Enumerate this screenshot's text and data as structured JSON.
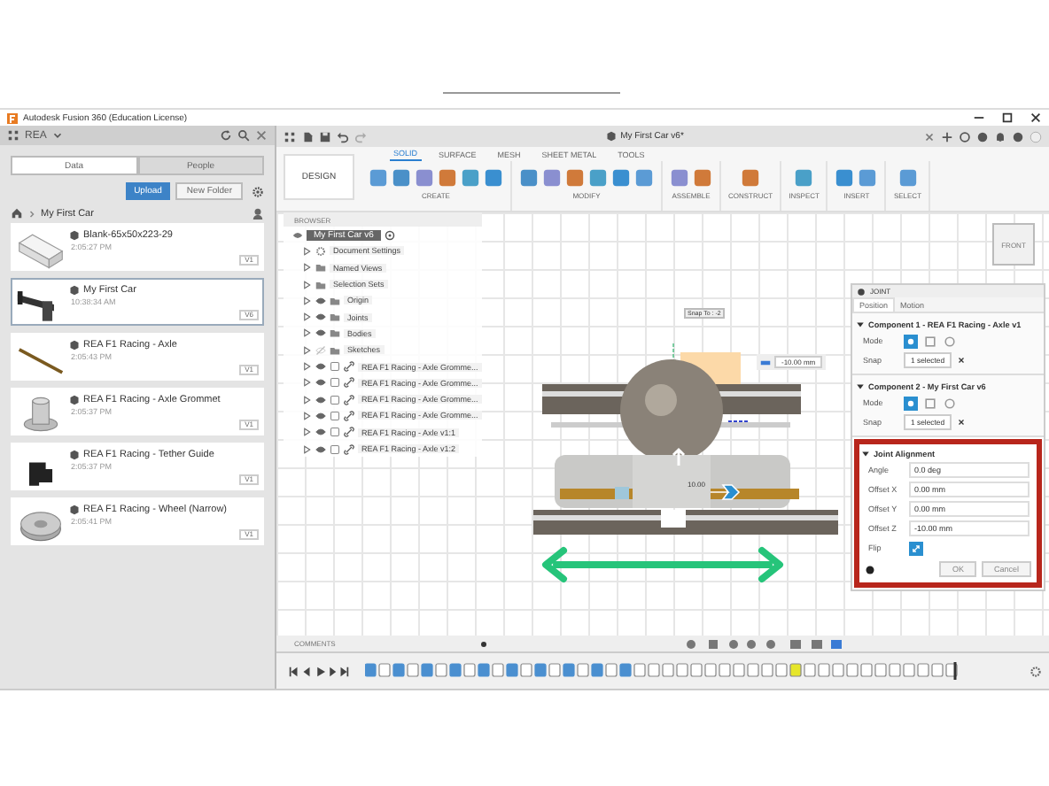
{
  "window": {
    "title": "Autodesk Fusion 360 (Education License)"
  },
  "data_panel": {
    "project": "REA",
    "tabs": [
      {
        "label": "Data",
        "selected": true
      },
      {
        "label": "People",
        "selected": false
      }
    ],
    "upload": "Upload",
    "new_folder": "New Folder",
    "breadcrumb": "My First Car",
    "files": [
      {
        "name": "Blank-65x50x223-29",
        "time": "2:05:27 PM",
        "version": "V1",
        "selected": false,
        "kind": "block"
      },
      {
        "name": "My First Car",
        "time": "10:38:34 AM",
        "version": "V6",
        "selected": true,
        "kind": "car"
      },
      {
        "name": "REA F1 Racing - Axle",
        "time": "2:05:43 PM",
        "version": "V1",
        "selected": false,
        "kind": "rod"
      },
      {
        "name": "REA F1 Racing - Axle Grommet",
        "time": "2:05:37 PM",
        "version": "V1",
        "selected": false,
        "kind": "grommet"
      },
      {
        "name": "REA F1 Racing - Tether Guide",
        "time": "2:05:37 PM",
        "version": "V1",
        "selected": false,
        "kind": "guide"
      },
      {
        "name": "REA F1 Racing - Wheel (Narrow)",
        "time": "2:05:41 PM",
        "version": "V1",
        "selected": false,
        "kind": "wheel"
      }
    ]
  },
  "document_tab": {
    "title": "My First Car v6*"
  },
  "toolbar": {
    "workspace": "DESIGN",
    "tabs": [
      {
        "label": "SOLID",
        "selected": true
      },
      {
        "label": "SURFACE",
        "selected": false
      },
      {
        "label": "MESH",
        "selected": false
      },
      {
        "label": "SHEET METAL",
        "selected": false
      },
      {
        "label": "TOOLS",
        "selected": false
      }
    ],
    "groups": [
      "CREATE",
      "MODIFY",
      "ASSEMBLE",
      "CONSTRUCT",
      "INSPECT",
      "INSERT",
      "SELECT"
    ]
  },
  "browser": {
    "title": "BROWSER",
    "root": "My First Car v6",
    "items": [
      {
        "label": "Document Settings",
        "kind": "settings"
      },
      {
        "label": "Named Views",
        "kind": "views"
      },
      {
        "label": "Selection Sets",
        "kind": "views"
      },
      {
        "label": "Origin",
        "kind": "folder",
        "visible": true
      },
      {
        "label": "Joints",
        "kind": "folder",
        "visible": true
      },
      {
        "label": "Bodies",
        "kind": "folder",
        "visible": true
      },
      {
        "label": "Sketches",
        "kind": "folder",
        "visible": false
      },
      {
        "label": "REA F1 Racing - Axle Gromme...",
        "kind": "component",
        "visible": true
      },
      {
        "label": "REA F1 Racing - Axle Gromme...",
        "kind": "component",
        "visible": true
      },
      {
        "label": "REA F1 Racing - Axle Gromme...",
        "kind": "component",
        "visible": true
      },
      {
        "label": "REA F1 Racing - Axle Gromme...",
        "kind": "component",
        "visible": true
      },
      {
        "label": "REA F1 Racing - Axle v1:1",
        "kind": "component",
        "visible": true
      },
      {
        "label": "REA F1 Racing - Axle v1:2",
        "kind": "component",
        "visible": true
      }
    ]
  },
  "viewcube": {
    "label": "FRONT"
  },
  "canvas": {
    "snap_tooltip": "Snap To : -2",
    "distance_value": "-10.00 mm",
    "dimension": "10.00"
  },
  "joint": {
    "title": "JOINT",
    "tabs": [
      {
        "label": "Position",
        "selected": true
      },
      {
        "label": "Motion",
        "selected": false
      }
    ],
    "components": [
      {
        "header": "Component 1 - REA F1 Racing - Axle v1",
        "mode": "Mode",
        "snap": "Snap",
        "selection": "1 selected"
      },
      {
        "header": "Component 2 - My First Car v6",
        "mode": "Mode",
        "snap": "Snap",
        "selection": "1 selected"
      }
    ],
    "alignment": {
      "header": "Joint Alignment",
      "fields": [
        {
          "label": "Angle",
          "value": "0.0 deg"
        },
        {
          "label": "Offset X",
          "value": "0.00 mm"
        },
        {
          "label": "Offset Y",
          "value": "0.00 mm"
        },
        {
          "label": "Offset Z",
          "value": "-10.00 mm"
        }
      ],
      "flip": "Flip"
    },
    "ok": "OK",
    "cancel": "Cancel"
  },
  "comments": {
    "label": "COMMENTS"
  }
}
